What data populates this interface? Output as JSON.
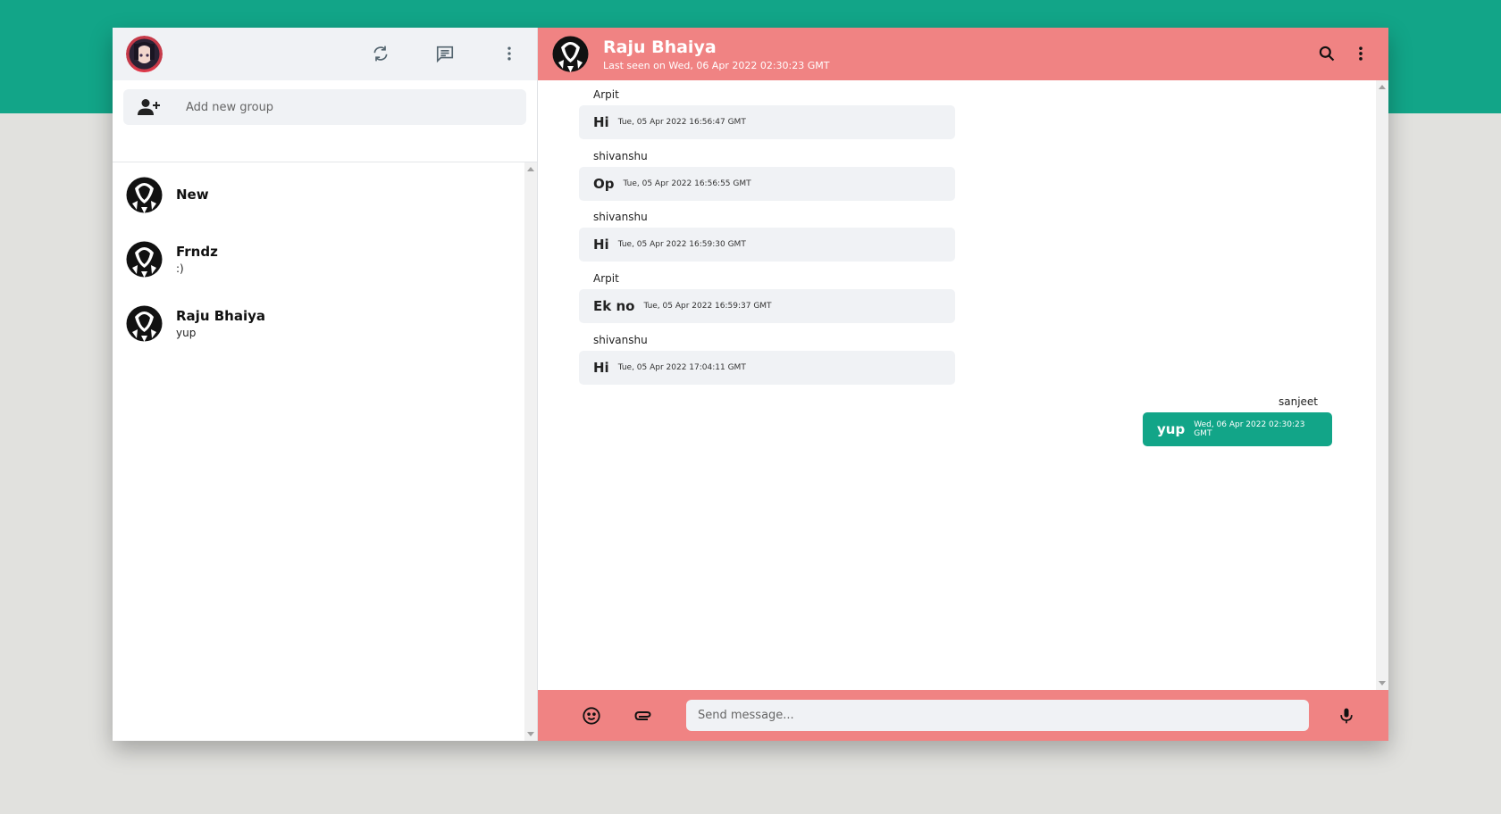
{
  "theme": {
    "accent": "#12a588",
    "header_pink": "#f08383",
    "panel_gray": "#f0f2f5"
  },
  "sidebar": {
    "header_icons": [
      "refresh-icon",
      "message-icon",
      "more-vert-icon"
    ],
    "group_input_placeholder": "Add new group",
    "chats": [
      {
        "name": "New",
        "last": ""
      },
      {
        "name": "Frndz",
        "last": ":)"
      },
      {
        "name": "Raju Bhaiya",
        "last": "yup"
      }
    ]
  },
  "conversation": {
    "name": "Raju Bhaiya",
    "status": "Last seen on Wed, 06 Apr 2022 02:30:23 GMT",
    "messages": [
      {
        "author": "Arpit",
        "text": "Hi",
        "time": "Tue, 05 Apr 2022 16:56:47 GMT",
        "mine": false
      },
      {
        "author": "shivanshu",
        "text": "Op",
        "time": "Tue, 05 Apr 2022 16:56:55 GMT",
        "mine": false
      },
      {
        "author": "shivanshu",
        "text": "Hi",
        "time": "Tue, 05 Apr 2022 16:59:30 GMT",
        "mine": false
      },
      {
        "author": "Arpit",
        "text": "Ek no",
        "time": "Tue, 05 Apr 2022 16:59:37 GMT",
        "mine": false
      },
      {
        "author": "shivanshu",
        "text": "Hi",
        "time": "Tue, 05 Apr 2022 17:04:11 GMT",
        "mine": false
      },
      {
        "author": "sanjeet",
        "text": "yup",
        "time": "Wed, 06 Apr 2022 02:30:23 GMT",
        "mine": true
      }
    ]
  },
  "composer": {
    "placeholder": "Send message..."
  }
}
